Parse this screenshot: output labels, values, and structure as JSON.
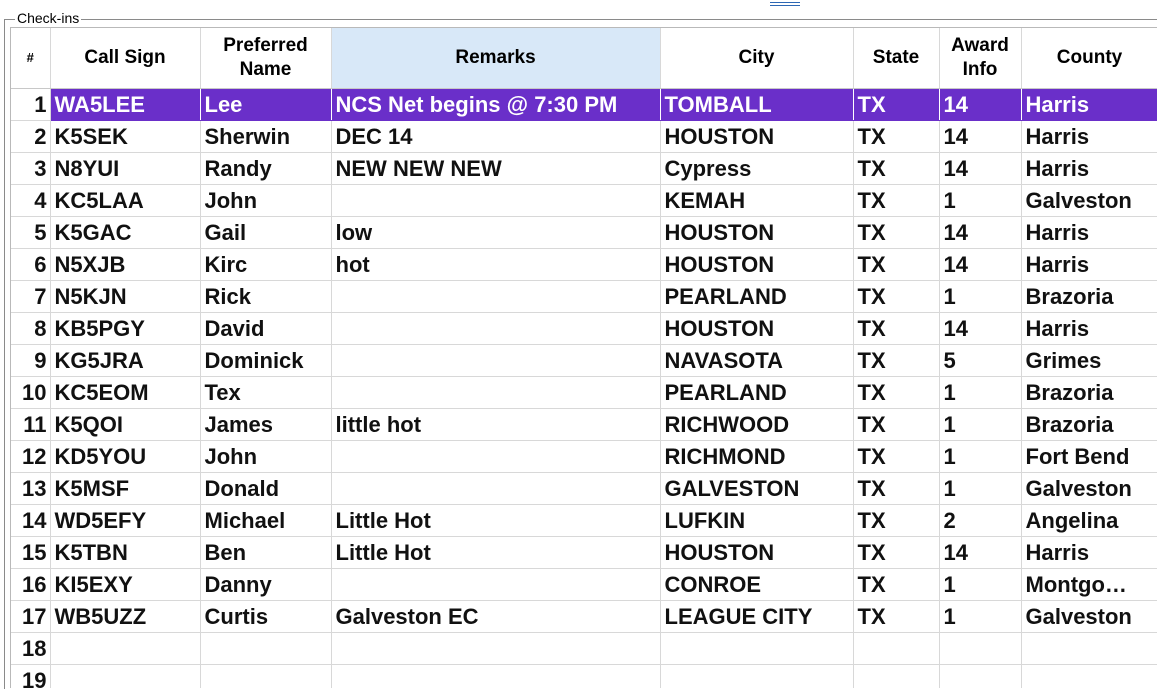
{
  "groupbox": {
    "title": "Check-ins"
  },
  "columns": [
    {
      "key": "num",
      "label": "#"
    },
    {
      "key": "call",
      "label": "Call Sign"
    },
    {
      "key": "name",
      "label": "Preferred\nName"
    },
    {
      "key": "remarks",
      "label": "Remarks"
    },
    {
      "key": "city",
      "label": "City"
    },
    {
      "key": "state",
      "label": "State"
    },
    {
      "key": "award",
      "label": "Award\nInfo"
    },
    {
      "key": "county",
      "label": "County"
    }
  ],
  "selection": {
    "selected_row": 1,
    "color": "#6a2fc9",
    "sorted_column_bg": "#d8e8f8"
  },
  "rows": [
    {
      "num": "1",
      "call": "WA5LEE",
      "name": "Lee",
      "remarks": "NCS Net begins @ 7:30 PM",
      "city": "TOMBALL",
      "state": "TX",
      "award": "14",
      "county": "Harris"
    },
    {
      "num": "2",
      "call": "K5SEK",
      "name": "Sherwin",
      "remarks": "DEC 14",
      "city": "HOUSTON",
      "state": "TX",
      "award": "14",
      "county": "Harris"
    },
    {
      "num": "3",
      "call": "N8YUI",
      "name": "Randy",
      "remarks": "NEW NEW NEW",
      "city": "Cypress",
      "state": "TX",
      "award": "14",
      "county": "Harris"
    },
    {
      "num": "4",
      "call": "KC5LAA",
      "name": "John",
      "remarks": "",
      "city": "KEMAH",
      "state": "TX",
      "award": "1",
      "county": "Galveston"
    },
    {
      "num": "5",
      "call": "K5GAC",
      "name": "Gail",
      "remarks": "low",
      "city": "HOUSTON",
      "state": "TX",
      "award": "14",
      "county": "Harris"
    },
    {
      "num": "6",
      "call": "N5XJB",
      "name": "Kirc",
      "remarks": "hot",
      "city": "HOUSTON",
      "state": "TX",
      "award": "14",
      "county": "Harris"
    },
    {
      "num": "7",
      "call": "N5KJN",
      "name": "Rick",
      "remarks": "",
      "city": "PEARLAND",
      "state": "TX",
      "award": "1",
      "county": "Brazoria"
    },
    {
      "num": "8",
      "call": "KB5PGY",
      "name": "David",
      "remarks": "",
      "city": "HOUSTON",
      "state": "TX",
      "award": "14",
      "county": "Harris"
    },
    {
      "num": "9",
      "call": "KG5JRA",
      "name": "Dominick",
      "remarks": "",
      "city": "NAVASOTA",
      "state": "TX",
      "award": "5",
      "county": "Grimes"
    },
    {
      "num": "10",
      "call": "KC5EOM",
      "name": "Tex",
      "remarks": "",
      "city": "PEARLAND",
      "state": "TX",
      "award": "1",
      "county": "Brazoria"
    },
    {
      "num": "11",
      "call": "K5QOI",
      "name": "James",
      "remarks": "little hot",
      "city": "RICHWOOD",
      "state": "TX",
      "award": "1",
      "county": "Brazoria"
    },
    {
      "num": "12",
      "call": "KD5YOU",
      "name": "John",
      "remarks": "",
      "city": "RICHMOND",
      "state": "TX",
      "award": "1",
      "county": "Fort Bend"
    },
    {
      "num": "13",
      "call": "K5MSF",
      "name": "Donald",
      "remarks": "",
      "city": "GALVESTON",
      "state": "TX",
      "award": "1",
      "county": "Galveston"
    },
    {
      "num": "14",
      "call": "WD5EFY",
      "name": "Michael",
      "remarks": "Little Hot",
      "city": "LUFKIN",
      "state": "TX",
      "award": "2",
      "county": "Angelina"
    },
    {
      "num": "15",
      "call": "K5TBN",
      "name": "Ben",
      "remarks": "Little Hot",
      "city": "HOUSTON",
      "state": "TX",
      "award": "14",
      "county": "Harris"
    },
    {
      "num": "16",
      "call": "KI5EXY",
      "name": "Danny",
      "remarks": "",
      "city": "CONROE",
      "state": "TX",
      "award": "1",
      "county": "Montgo…"
    },
    {
      "num": "17",
      "call": "WB5UZZ",
      "name": "Curtis",
      "remarks": "Galveston EC",
      "city": "LEAGUE CITY",
      "state": "TX",
      "award": "1",
      "county": "Galveston"
    },
    {
      "num": "18",
      "call": "",
      "name": "",
      "remarks": "",
      "city": "",
      "state": "",
      "award": "",
      "county": ""
    },
    {
      "num": "19",
      "call": "",
      "name": "",
      "remarks": "",
      "city": "",
      "state": "",
      "award": "",
      "county": ""
    }
  ]
}
